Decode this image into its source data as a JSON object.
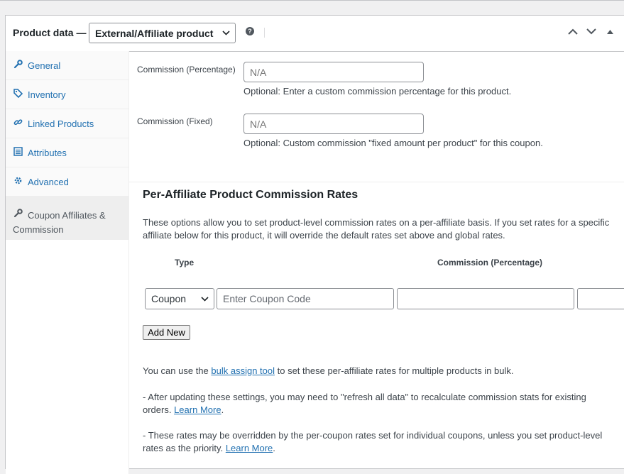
{
  "header": {
    "title": "Product data —",
    "product_type": "External/Affiliate product",
    "help_glyph": "?"
  },
  "sidebar": {
    "items": [
      {
        "label": "General",
        "icon": "wrench-icon"
      },
      {
        "label": "Inventory",
        "icon": "tag-icon"
      },
      {
        "label": "Linked Products",
        "icon": "link-icon"
      },
      {
        "label": "Attributes",
        "icon": "list-icon"
      },
      {
        "label": "Advanced",
        "icon": "gear-icon"
      },
      {
        "label": "Coupon Affiliates & Commission",
        "icon": "wrench-icon",
        "active": true
      }
    ]
  },
  "fields": {
    "commission_pct": {
      "label": "Commission (Percentage)",
      "placeholder": "N/A",
      "desc": "Optional: Enter a custom commission percentage for this product."
    },
    "commission_fixed": {
      "label": "Commission (Fixed)",
      "placeholder": "N/A",
      "desc": "Optional: Custom commission \"fixed amount per product\" for this coupon."
    }
  },
  "rates": {
    "title": "Per-Affiliate Product Commission Rates",
    "desc": "These options allow you to set product-level commission rates on a per-affiliate basis. If you set rates for a specific affiliate below for this product, it will override the default rates set above and global rates.",
    "col_type": "Type",
    "col_commission": "Commission (Percentage)",
    "row": {
      "type_value": "Coupon",
      "coupon_placeholder": "Enter Coupon Code",
      "commission_value": ""
    },
    "add_label": "Add New"
  },
  "notes": {
    "bulk_pre": "You can use the ",
    "bulk_link": "bulk assign tool",
    "bulk_post": " to set these per-affiliate rates for multiple products in bulk.",
    "refresh_pre": "- After updating these settings, you may need to \"refresh all data\" to recalculate commission stats for existing orders. ",
    "refresh_link": "Learn More",
    "refresh_post": ".",
    "override_pre": "- These rates may be overridden by the per-coupon rates set for individual coupons, unless you set product-level rates as the priority. ",
    "override_link": "Learn More",
    "override_post": "."
  },
  "colors": {
    "link": "#2271b1",
    "border": "#c3c4c7",
    "text": "#3c434a"
  }
}
